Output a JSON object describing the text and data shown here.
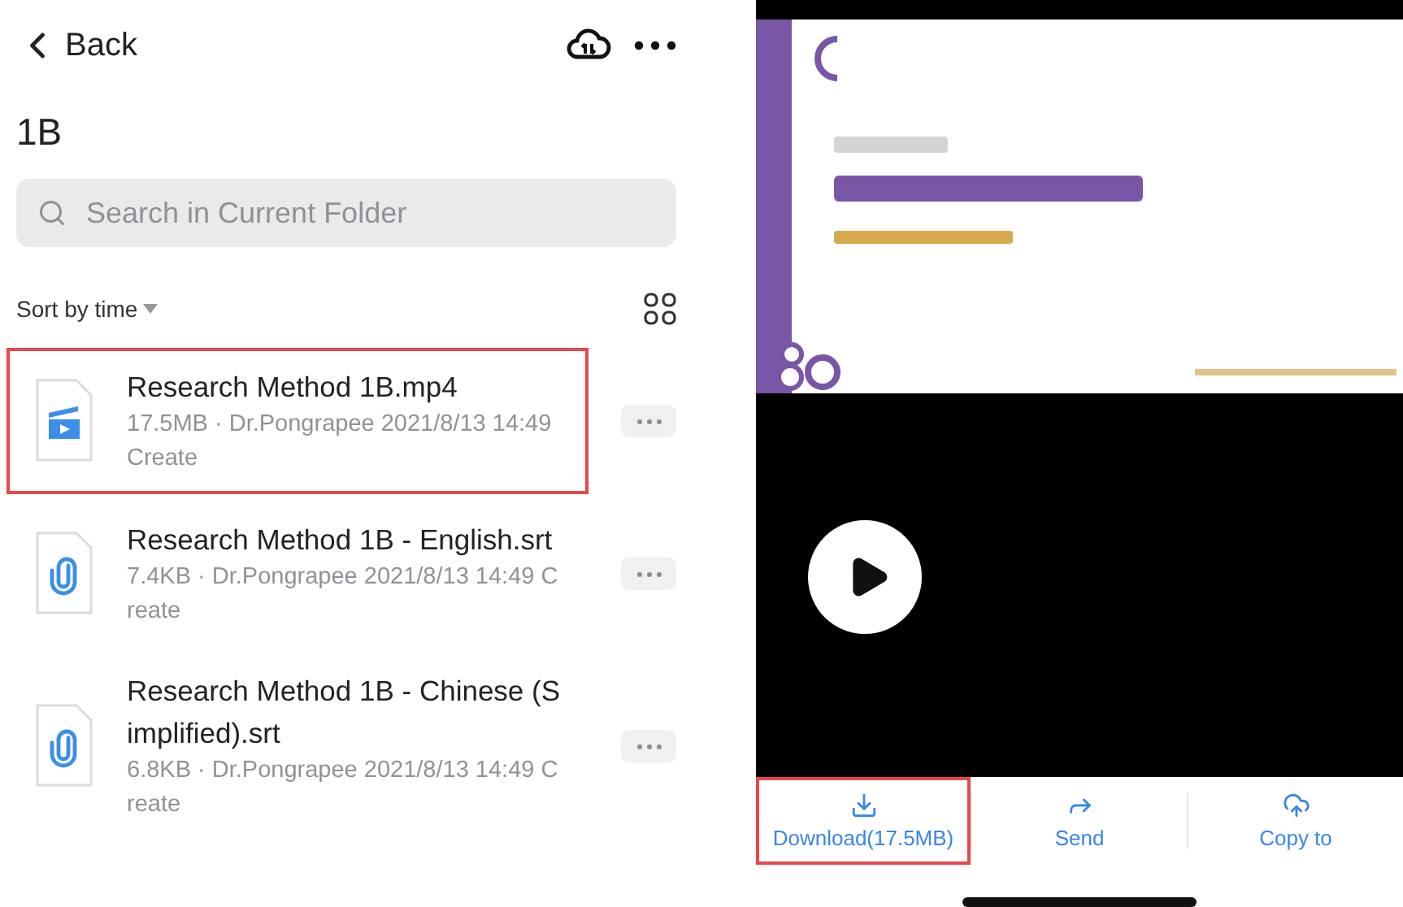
{
  "header": {
    "back_label": "Back"
  },
  "folder": {
    "title": "1B"
  },
  "search": {
    "placeholder": "Search in Current Folder"
  },
  "sort": {
    "label": "Sort by time"
  },
  "files": [
    {
      "kind": "video",
      "name": "Research Method 1B.mp4",
      "meta": "17.5MB · Dr.Pongrapee 2021/8/13 14:49 Create",
      "highlighted": true
    },
    {
      "kind": "attachment",
      "name": "Research Method 1B - English.srt",
      "meta": "7.4KB · Dr.Pongrapee 2021/8/13 14:49 Create",
      "highlighted": false
    },
    {
      "kind": "attachment",
      "name": "Research Method 1B - Chinese (Simplified).srt",
      "meta": "6.8KB · Dr.Pongrapee 2021/8/13 14:49 Create",
      "highlighted": false
    }
  ],
  "viewer": {
    "actions": [
      {
        "kind": "download",
        "label": "Download(17.5MB)",
        "highlighted": true
      },
      {
        "kind": "send",
        "label": "Send",
        "highlighted": false
      },
      {
        "kind": "copy",
        "label": "Copy to",
        "highlighted": false
      }
    ]
  }
}
